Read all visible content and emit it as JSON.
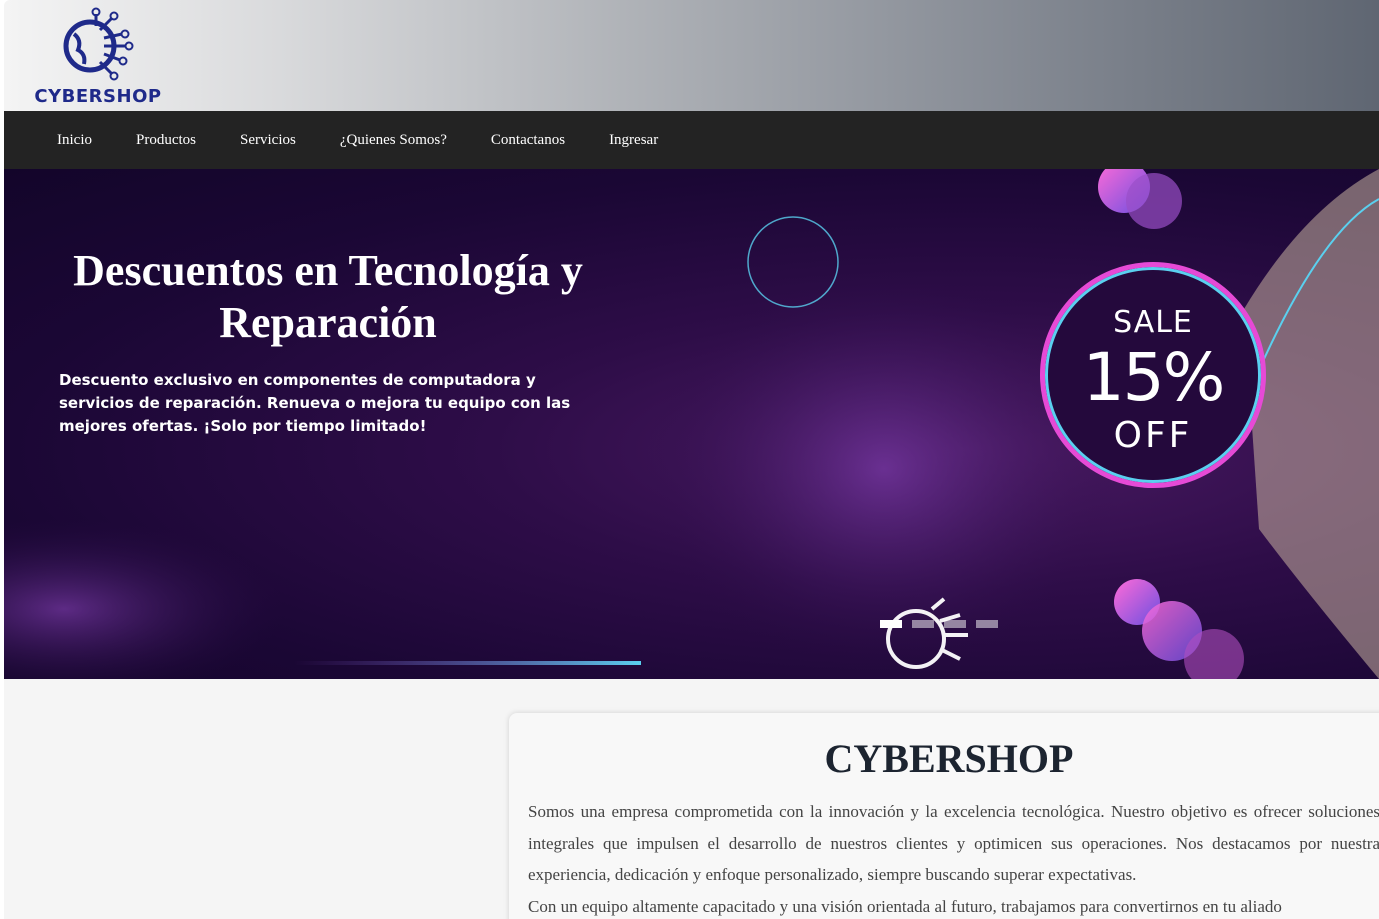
{
  "brand": {
    "name": "CYBERSHOP"
  },
  "nav": {
    "items": [
      "Inicio",
      "Productos",
      "Servicios",
      "¿Quienes Somos?",
      "Contactanos",
      "Ingresar"
    ]
  },
  "hero": {
    "title": "Descuentos en Tecnología y Reparación",
    "description": "Descuento exclusivo en componentes de computadora y servicios de reparación. Renueva o mejora tu equipo con las mejores ofertas. ¡Solo por tiempo limitado!",
    "sale_badge": {
      "top": "SALE",
      "percent": "15%",
      "bottom": "OFF"
    },
    "carousel": {
      "slides": 4,
      "active": 0
    }
  },
  "about": {
    "title": "CYBERSHOP",
    "paragraphs": [
      "Somos una empresa comprometida con la innovación y la excelencia tecnológica. Nuestro objetivo es ofrecer soluciones integrales que impulsen el desarrollo de nuestros clientes y optimicen sus operaciones. Nos destacamos por nuestra experiencia, dedicación y enfoque personalizado, siempre buscando superar expectativas.",
      "Con un equipo altamente capacitado y una visión orientada al futuro, trabajamos para convertirnos en tu aliado"
    ]
  },
  "colors": {
    "nav_bg": "#232323",
    "brand_blue": "#1f2a8a",
    "hero_bg": "#1b0735",
    "accent_pink": "#e64ad6",
    "accent_cyan": "#5ad0ef"
  }
}
